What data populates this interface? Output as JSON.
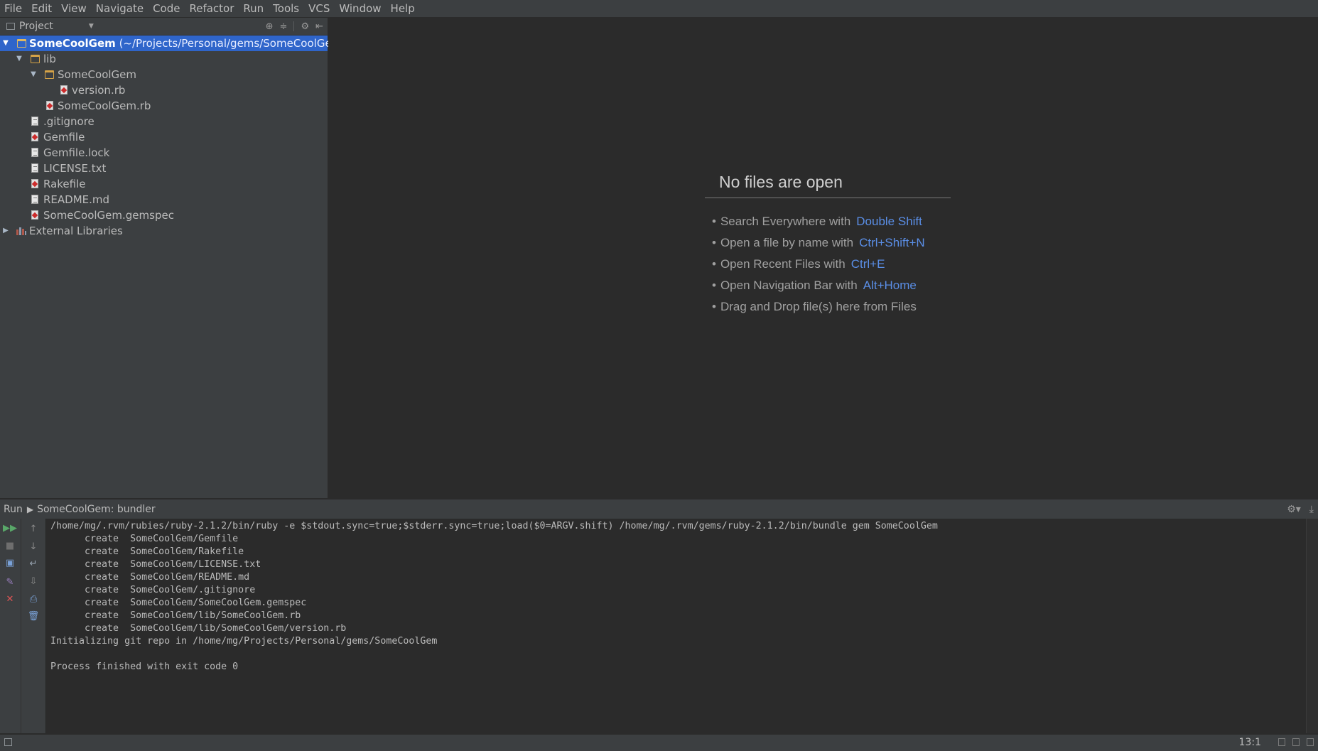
{
  "menu": [
    "File",
    "Edit",
    "View",
    "Navigate",
    "Code",
    "Refactor",
    "Run",
    "Tools",
    "VCS",
    "Window",
    "Help"
  ],
  "project_panel": {
    "view_label": "Project",
    "tree": [
      {
        "name": "SomeCoolGem",
        "hint": "(~/Projects/Personal/gems/SomeCoolGem)"
      },
      {
        "name": "lib"
      },
      {
        "name": "SomeCoolGem"
      },
      {
        "name": "version.rb"
      },
      {
        "name": "SomeCoolGem.rb"
      },
      {
        "name": ".gitignore"
      },
      {
        "name": "Gemfile"
      },
      {
        "name": "Gemfile.lock"
      },
      {
        "name": "LICENSE.txt"
      },
      {
        "name": "Rakefile"
      },
      {
        "name": "README.md"
      },
      {
        "name": "SomeCoolGem.gemspec"
      },
      {
        "name": "External Libraries"
      }
    ]
  },
  "editor": {
    "empty_title": "No files are open",
    "hints": [
      {
        "text": "Search Everywhere with",
        "shortcut": "Double Shift"
      },
      {
        "text": "Open a file by name with",
        "shortcut": "Ctrl+Shift+N"
      },
      {
        "text": "Open Recent Files with",
        "shortcut": "Ctrl+E"
      },
      {
        "text": "Open Navigation Bar with",
        "shortcut": "Alt+Home"
      },
      {
        "text": "Drag and Drop file(s) here from Files",
        "shortcut": ""
      }
    ]
  },
  "run": {
    "label": "Run",
    "config": "SomeCoolGem: bundler",
    "console": "/home/mg/.rvm/rubies/ruby-2.1.2/bin/ruby -e $stdout.sync=true;$stderr.sync=true;load($0=ARGV.shift) /home/mg/.rvm/gems/ruby-2.1.2/bin/bundle gem SomeCoolGem\n      create  SomeCoolGem/Gemfile\n      create  SomeCoolGem/Rakefile\n      create  SomeCoolGem/LICENSE.txt\n      create  SomeCoolGem/README.md\n      create  SomeCoolGem/.gitignore\n      create  SomeCoolGem/SomeCoolGem.gemspec\n      create  SomeCoolGem/lib/SomeCoolGem.rb\n      create  SomeCoolGem/lib/SomeCoolGem/version.rb\nInitializing git repo in /home/mg/Projects/Personal/gems/SomeCoolGem\n\nProcess finished with exit code 0"
  },
  "status": {
    "caret_position": "13:1"
  },
  "colors": {
    "selection": "#2f65ca",
    "shortcut": "#5a8ee6",
    "panel_bg": "#3c3f41",
    "editor_bg": "#2b2b2b",
    "folder": "#d6a347",
    "ruby_file": "#cc2b2b"
  }
}
